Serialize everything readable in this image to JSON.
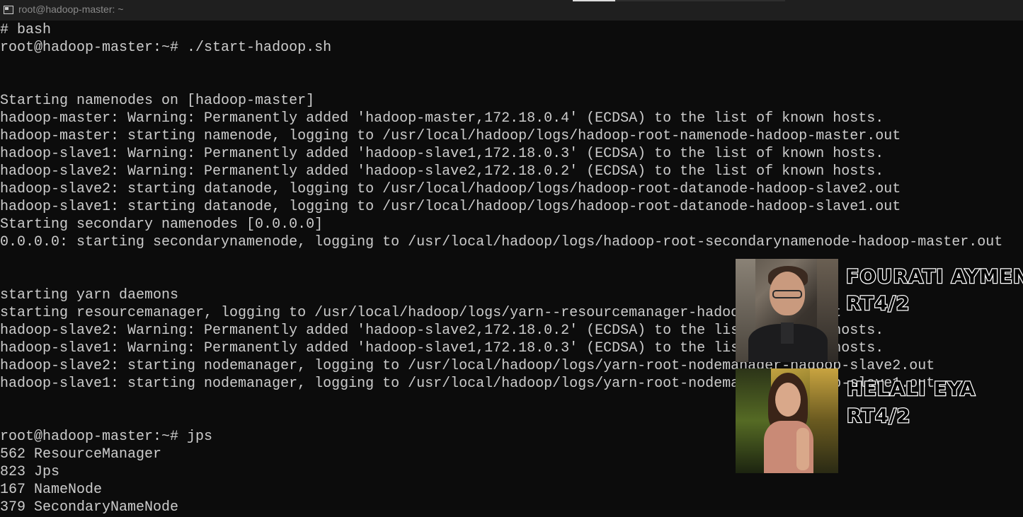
{
  "window": {
    "title": "root@hadoop-master: ~"
  },
  "terminal": {
    "lines": [
      "# bash",
      "root@hadoop-master:~# ./start-hadoop.sh",
      "",
      "",
      "Starting namenodes on [hadoop-master]",
      "hadoop-master: Warning: Permanently added 'hadoop-master,172.18.0.4' (ECDSA) to the list of known hosts.",
      "hadoop-master: starting namenode, logging to /usr/local/hadoop/logs/hadoop-root-namenode-hadoop-master.out",
      "hadoop-slave1: Warning: Permanently added 'hadoop-slave1,172.18.0.3' (ECDSA) to the list of known hosts.",
      "hadoop-slave2: Warning: Permanently added 'hadoop-slave2,172.18.0.2' (ECDSA) to the list of known hosts.",
      "hadoop-slave2: starting datanode, logging to /usr/local/hadoop/logs/hadoop-root-datanode-hadoop-slave2.out",
      "hadoop-slave1: starting datanode, logging to /usr/local/hadoop/logs/hadoop-root-datanode-hadoop-slave1.out",
      "Starting secondary namenodes [0.0.0.0]",
      "0.0.0.0: starting secondarynamenode, logging to /usr/local/hadoop/logs/hadoop-root-secondarynamenode-hadoop-master.out",
      "",
      "",
      "starting yarn daemons",
      "starting resourcemanager, logging to /usr/local/hadoop/logs/yarn--resourcemanager-hadoop-master.out",
      "hadoop-slave2: Warning: Permanently added 'hadoop-slave2,172.18.0.2' (ECDSA) to the list of known hosts.",
      "hadoop-slave1: Warning: Permanently added 'hadoop-slave1,172.18.0.3' (ECDSA) to the list of known hosts.",
      "hadoop-slave2: starting nodemanager, logging to /usr/local/hadoop/logs/yarn-root-nodemanager-hadoop-slave2.out",
      "hadoop-slave1: starting nodemanager, logging to /usr/local/hadoop/logs/yarn-root-nodemanager-hadoop-slave1.out",
      "",
      "",
      "root@hadoop-master:~# jps",
      "562 ResourceManager",
      "823 Jps",
      "167 NameNode",
      "379 SecondaryNameNode"
    ]
  },
  "overlay": {
    "person1": {
      "name": "FOURATI AYMEN",
      "class": "RT4/2"
    },
    "person2": {
      "name": "HELALI EYA",
      "class": "RT4/2"
    }
  },
  "colors": {
    "terminal_bg": "#0c0c0c",
    "terminal_fg": "#cccccc",
    "titlebar_bg": "#1f1f1f"
  }
}
